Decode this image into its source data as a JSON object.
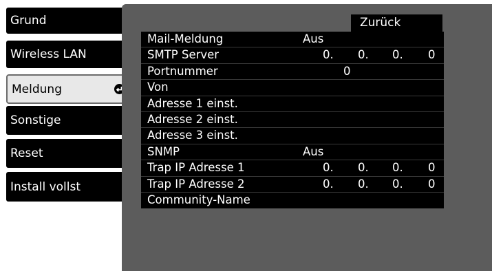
{
  "sidebar": {
    "items": [
      {
        "label": "Grund"
      },
      {
        "label": "Wireless LAN"
      },
      {
        "label": "Meldung",
        "selected": true
      },
      {
        "label": "Sonstige"
      },
      {
        "label": "Reset"
      },
      {
        "label": "Install vollst"
      }
    ]
  },
  "back_button": {
    "label": "Zurück"
  },
  "settings": {
    "rows": [
      {
        "label": "Mail-Meldung",
        "value": "Aus"
      },
      {
        "label": "SMTP Server",
        "ip": [
          "0.",
          "0.",
          "0.",
          "0"
        ]
      },
      {
        "label": "Portnummer",
        "value": "0"
      },
      {
        "label": "Von"
      },
      {
        "label": "Adresse 1 einst."
      },
      {
        "label": "Adresse 2 einst."
      },
      {
        "label": "Adresse 3 einst."
      },
      {
        "label": "SNMP",
        "value": "Aus"
      },
      {
        "label": "Trap IP Adresse 1",
        "ip": [
          "0.",
          "0.",
          "0.",
          "0"
        ]
      },
      {
        "label": "Trap IP Adresse 2",
        "ip": [
          "0.",
          "0.",
          "0.",
          "0"
        ]
      },
      {
        "label": "Community-Name"
      }
    ]
  },
  "colors": {
    "panel": "#5c5c5c",
    "menu_bg": "#000000",
    "menu_selected_bg": "#e8e8e8",
    "text": "#ffffff"
  }
}
